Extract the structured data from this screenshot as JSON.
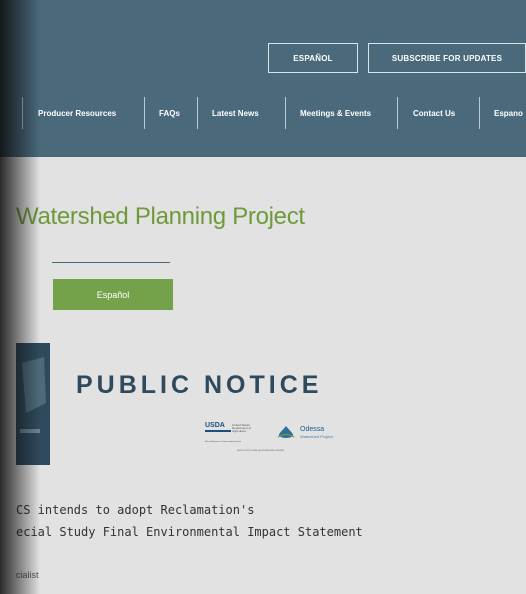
{
  "header": {
    "espanol_button": "ESPAÑOL",
    "subscribe_button": "SUBSCRIBE FOR UPDATES"
  },
  "nav": {
    "items": [
      "Producer Resources",
      "FAQs",
      "Latest News",
      "Meetings & Events",
      "Contact Us",
      "Espano"
    ]
  },
  "main": {
    "title": "Watershed Planning Project",
    "espanol_button": "Español"
  },
  "notice": {
    "heading": "PUBLIC NOTICE",
    "usda": "USDA",
    "usda_small": "United States Department of Agriculture",
    "usda_sub": "Natural Resources Conservation Service",
    "odessa": "Odessa",
    "odessa_sub": "Watershed Project",
    "url": "www.nrcs.usda.gov/watershed-plan",
    "line1": "CS intends to adopt Reclamation's",
    "line2": "ecial Study Final Environmental Impact Statement",
    "specialist": "cialist"
  },
  "colors": {
    "header_bg": "#4a6a7c",
    "title_green": "#6f9a3b",
    "button_green": "#73a24a",
    "notice_blue": "#2f4a5c"
  }
}
